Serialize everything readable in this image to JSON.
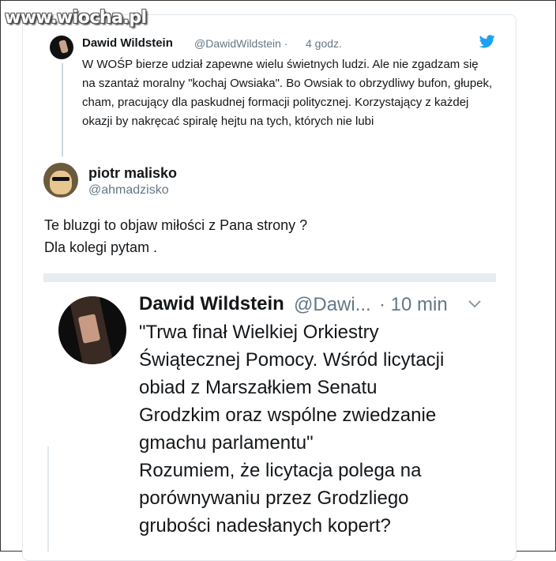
{
  "watermark": "www.wiocha.pl",
  "quoted_tweet": {
    "author_name": "Dawid Wildstein",
    "author_handle": "@DawidWildstein",
    "separator": "·",
    "time": "4 godz.",
    "icon": "twitter-bird-icon",
    "text": "W WOŚP bierze udział zapewne wielu świetnych ludzi. Ale nie zgadzam się na szantaż moralny \"kochaj Owsiaka\". Bo Owsiak to obrzydliwy bufon, głupek, cham, pracujący dla paskudnej formacji politycznej. Korzystający z każdej okazji by nakręcać spiralę hejtu na tych, których nie lubi"
  },
  "reply_tweet": {
    "author_name": "piotr malisko",
    "author_handle": "@ahmadzisko",
    "line1": "Te bluzgi to objaw miłości z Pana strony ?",
    "line2": "Dla kolegi pytam ."
  },
  "embedded_tweet": {
    "author_name": "Dawid Wildstein",
    "author_handle": "@Dawi...",
    "separator": "·",
    "time": "10 min",
    "lines": [
      "\"Trwa finał Wielkiej Orkiestry",
      "Świątecznej Pomocy. Wśród licytacji",
      "obiad z Marszałkiem Senatu",
      "Grodzkim oraz wspólne zwiedzanie",
      "gmachu parlamentu\"",
      "Rozumiem,  że licytacja polega na",
      "porównywaniu przez Grodzliego",
      "grubości nadesłanych kopert?"
    ]
  },
  "colors": {
    "twitter_blue": "#1da1f2",
    "text": "#14171a",
    "secondary": "#657786",
    "divider": "#e6ecf0"
  }
}
